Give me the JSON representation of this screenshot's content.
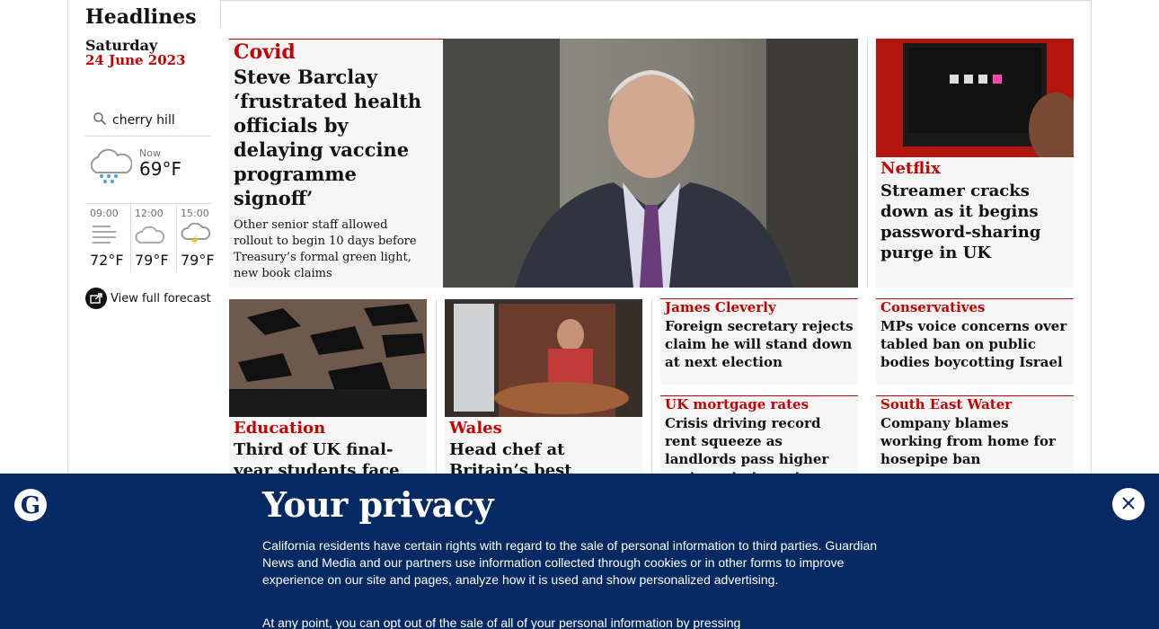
{
  "sidebar": {
    "title": "Headlines",
    "day": "Saturday",
    "date": "24 June 2023",
    "search_value": "cherry hill",
    "weather_now_label": "Now",
    "weather_now_temp": "69°F",
    "forecast": [
      {
        "time": "09:00",
        "temp": "72°F",
        "icon": "fog-icon"
      },
      {
        "time": "12:00",
        "temp": "79°F",
        "icon": "cloud-icon"
      },
      {
        "time": "15:00",
        "temp": "79°F",
        "icon": "thunder-icon"
      }
    ],
    "full_forecast_label": "View full forecast"
  },
  "main_story": {
    "kicker": "Covid",
    "headline": "Steve Barclay ‘frustrated health officials by delaying vaccine programme signoff’",
    "standfirst": "Other senior staff allowed rollout to begin 10 days before Treasury’s formal green light, new book claims"
  },
  "netflix": {
    "kicker": "Netflix",
    "headline": "Streamer cracks down as it begins password-sharing purge in UK"
  },
  "education": {
    "kicker": "Education",
    "headline": "Third of UK final-year students face grades"
  },
  "wales": {
    "kicker": "Wales",
    "headline": "Head chef at Britain’s best restaurant"
  },
  "cleverly": {
    "kicker": "James Cleverly",
    "headline": "Foreign secretary rejects claim he will stand down at next election"
  },
  "conservatives": {
    "kicker": "Conservatives",
    "headline": "MPs voice concerns over tabled ban on public bodies boycotting Israel"
  },
  "mortgage": {
    "kicker": "UK mortgage rates",
    "headline": "Crisis driving record rent squeeze as landlords pass higher costs on to tenants"
  },
  "southeast": {
    "kicker": "South East Water",
    "headline": "Company blames working from home for hosepipe ban"
  },
  "privacy": {
    "title": "Your privacy",
    "para1": "California residents have certain rights with regard to the sale of personal information to third parties. Guardian News and Media and our partners use information collected through cookies or in other forms to improve experience on our site and pages, analyze how it is used and show personalized advertising.",
    "para2": "At any point, you can opt out of the sale of all of your personal information by pressing"
  },
  "colors": {
    "accent": "#c70000",
    "banner": "#052962"
  }
}
